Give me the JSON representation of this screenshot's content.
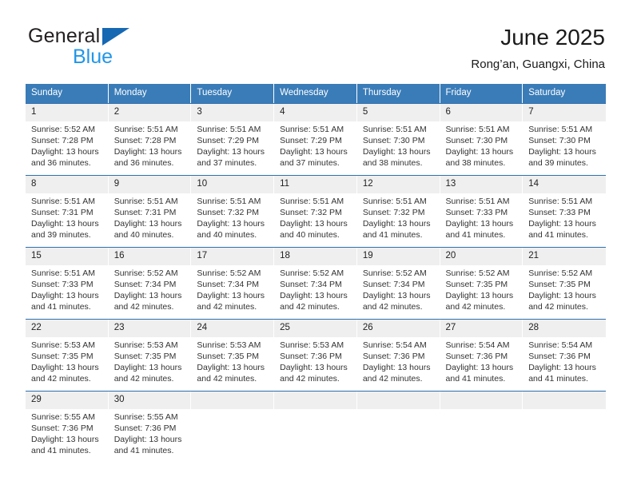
{
  "logo": {
    "word1": "General",
    "word2": "Blue",
    "triangle_color": "#1668b3",
    "word2_color": "#2196e8"
  },
  "header": {
    "title": "June 2025",
    "subtitle": "Rong’an, Guangxi, China"
  },
  "calendar": {
    "header_bg": "#3a7cb8",
    "datebar_bg": "#efefef",
    "rule_color": "#2f6fad",
    "weekdays": [
      "Sunday",
      "Monday",
      "Tuesday",
      "Wednesday",
      "Thursday",
      "Friday",
      "Saturday"
    ],
    "weeks": [
      {
        "dates": [
          "1",
          "2",
          "3",
          "4",
          "5",
          "6",
          "7"
        ],
        "cells": [
          {
            "sunrise": "Sunrise: 5:52 AM",
            "sunset": "Sunset: 7:28 PM",
            "daylight1": "Daylight: 13 hours",
            "daylight2": "and 36 minutes."
          },
          {
            "sunrise": "Sunrise: 5:51 AM",
            "sunset": "Sunset: 7:28 PM",
            "daylight1": "Daylight: 13 hours",
            "daylight2": "and 36 minutes."
          },
          {
            "sunrise": "Sunrise: 5:51 AM",
            "sunset": "Sunset: 7:29 PM",
            "daylight1": "Daylight: 13 hours",
            "daylight2": "and 37 minutes."
          },
          {
            "sunrise": "Sunrise: 5:51 AM",
            "sunset": "Sunset: 7:29 PM",
            "daylight1": "Daylight: 13 hours",
            "daylight2": "and 37 minutes."
          },
          {
            "sunrise": "Sunrise: 5:51 AM",
            "sunset": "Sunset: 7:30 PM",
            "daylight1": "Daylight: 13 hours",
            "daylight2": "and 38 minutes."
          },
          {
            "sunrise": "Sunrise: 5:51 AM",
            "sunset": "Sunset: 7:30 PM",
            "daylight1": "Daylight: 13 hours",
            "daylight2": "and 38 minutes."
          },
          {
            "sunrise": "Sunrise: 5:51 AM",
            "sunset": "Sunset: 7:30 PM",
            "daylight1": "Daylight: 13 hours",
            "daylight2": "and 39 minutes."
          }
        ]
      },
      {
        "dates": [
          "8",
          "9",
          "10",
          "11",
          "12",
          "13",
          "14"
        ],
        "cells": [
          {
            "sunrise": "Sunrise: 5:51 AM",
            "sunset": "Sunset: 7:31 PM",
            "daylight1": "Daylight: 13 hours",
            "daylight2": "and 39 minutes."
          },
          {
            "sunrise": "Sunrise: 5:51 AM",
            "sunset": "Sunset: 7:31 PM",
            "daylight1": "Daylight: 13 hours",
            "daylight2": "and 40 minutes."
          },
          {
            "sunrise": "Sunrise: 5:51 AM",
            "sunset": "Sunset: 7:32 PM",
            "daylight1": "Daylight: 13 hours",
            "daylight2": "and 40 minutes."
          },
          {
            "sunrise": "Sunrise: 5:51 AM",
            "sunset": "Sunset: 7:32 PM",
            "daylight1": "Daylight: 13 hours",
            "daylight2": "and 40 minutes."
          },
          {
            "sunrise": "Sunrise: 5:51 AM",
            "sunset": "Sunset: 7:32 PM",
            "daylight1": "Daylight: 13 hours",
            "daylight2": "and 41 minutes."
          },
          {
            "sunrise": "Sunrise: 5:51 AM",
            "sunset": "Sunset: 7:33 PM",
            "daylight1": "Daylight: 13 hours",
            "daylight2": "and 41 minutes."
          },
          {
            "sunrise": "Sunrise: 5:51 AM",
            "sunset": "Sunset: 7:33 PM",
            "daylight1": "Daylight: 13 hours",
            "daylight2": "and 41 minutes."
          }
        ]
      },
      {
        "dates": [
          "15",
          "16",
          "17",
          "18",
          "19",
          "20",
          "21"
        ],
        "cells": [
          {
            "sunrise": "Sunrise: 5:51 AM",
            "sunset": "Sunset: 7:33 PM",
            "daylight1": "Daylight: 13 hours",
            "daylight2": "and 41 minutes."
          },
          {
            "sunrise": "Sunrise: 5:52 AM",
            "sunset": "Sunset: 7:34 PM",
            "daylight1": "Daylight: 13 hours",
            "daylight2": "and 42 minutes."
          },
          {
            "sunrise": "Sunrise: 5:52 AM",
            "sunset": "Sunset: 7:34 PM",
            "daylight1": "Daylight: 13 hours",
            "daylight2": "and 42 minutes."
          },
          {
            "sunrise": "Sunrise: 5:52 AM",
            "sunset": "Sunset: 7:34 PM",
            "daylight1": "Daylight: 13 hours",
            "daylight2": "and 42 minutes."
          },
          {
            "sunrise": "Sunrise: 5:52 AM",
            "sunset": "Sunset: 7:34 PM",
            "daylight1": "Daylight: 13 hours",
            "daylight2": "and 42 minutes."
          },
          {
            "sunrise": "Sunrise: 5:52 AM",
            "sunset": "Sunset: 7:35 PM",
            "daylight1": "Daylight: 13 hours",
            "daylight2": "and 42 minutes."
          },
          {
            "sunrise": "Sunrise: 5:52 AM",
            "sunset": "Sunset: 7:35 PM",
            "daylight1": "Daylight: 13 hours",
            "daylight2": "and 42 minutes."
          }
        ]
      },
      {
        "dates": [
          "22",
          "23",
          "24",
          "25",
          "26",
          "27",
          "28"
        ],
        "cells": [
          {
            "sunrise": "Sunrise: 5:53 AM",
            "sunset": "Sunset: 7:35 PM",
            "daylight1": "Daylight: 13 hours",
            "daylight2": "and 42 minutes."
          },
          {
            "sunrise": "Sunrise: 5:53 AM",
            "sunset": "Sunset: 7:35 PM",
            "daylight1": "Daylight: 13 hours",
            "daylight2": "and 42 minutes."
          },
          {
            "sunrise": "Sunrise: 5:53 AM",
            "sunset": "Sunset: 7:35 PM",
            "daylight1": "Daylight: 13 hours",
            "daylight2": "and 42 minutes."
          },
          {
            "sunrise": "Sunrise: 5:53 AM",
            "sunset": "Sunset: 7:36 PM",
            "daylight1": "Daylight: 13 hours",
            "daylight2": "and 42 minutes."
          },
          {
            "sunrise": "Sunrise: 5:54 AM",
            "sunset": "Sunset: 7:36 PM",
            "daylight1": "Daylight: 13 hours",
            "daylight2": "and 42 minutes."
          },
          {
            "sunrise": "Sunrise: 5:54 AM",
            "sunset": "Sunset: 7:36 PM",
            "daylight1": "Daylight: 13 hours",
            "daylight2": "and 41 minutes."
          },
          {
            "sunrise": "Sunrise: 5:54 AM",
            "sunset": "Sunset: 7:36 PM",
            "daylight1": "Daylight: 13 hours",
            "daylight2": "and 41 minutes."
          }
        ]
      },
      {
        "dates": [
          "29",
          "30",
          "",
          "",
          "",
          "",
          ""
        ],
        "cells": [
          {
            "sunrise": "Sunrise: 5:55 AM",
            "sunset": "Sunset: 7:36 PM",
            "daylight1": "Daylight: 13 hours",
            "daylight2": "and 41 minutes."
          },
          {
            "sunrise": "Sunrise: 5:55 AM",
            "sunset": "Sunset: 7:36 PM",
            "daylight1": "Daylight: 13 hours",
            "daylight2": "and 41 minutes."
          },
          {
            "sunrise": "",
            "sunset": "",
            "daylight1": "",
            "daylight2": ""
          },
          {
            "sunrise": "",
            "sunset": "",
            "daylight1": "",
            "daylight2": ""
          },
          {
            "sunrise": "",
            "sunset": "",
            "daylight1": "",
            "daylight2": ""
          },
          {
            "sunrise": "",
            "sunset": "",
            "daylight1": "",
            "daylight2": ""
          },
          {
            "sunrise": "",
            "sunset": "",
            "daylight1": "",
            "daylight2": ""
          }
        ]
      }
    ]
  }
}
